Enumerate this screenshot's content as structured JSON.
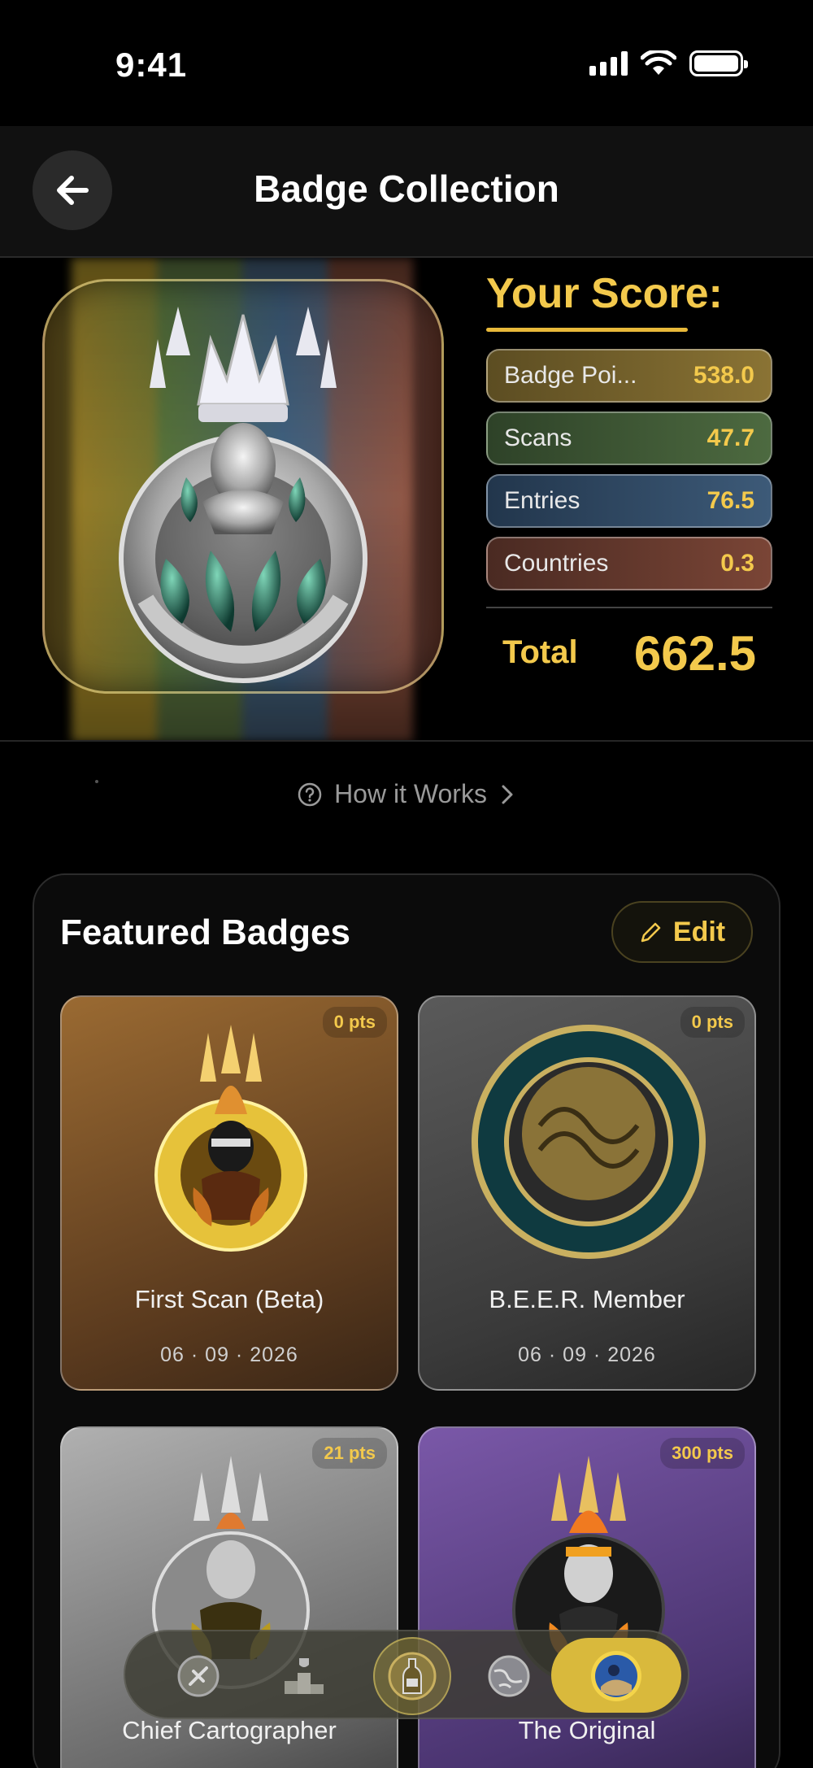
{
  "status_bar": {
    "time": "9:41"
  },
  "header": {
    "title": "Badge Collection"
  },
  "score": {
    "title": "Your Score:",
    "rows": [
      {
        "label": "Badge Poi...",
        "value": "538.0",
        "color": "#8a7334"
      },
      {
        "label": "Scans",
        "value": "47.7",
        "color": "#4d6a40"
      },
      {
        "label": "Entries",
        "value": "76.5",
        "color": "#3d5a78"
      },
      {
        "label": "Countries",
        "value": "0.3",
        "color": "#7a4536"
      }
    ],
    "total_label": "Total",
    "total_value": "662.5"
  },
  "how_it_works": {
    "label": "How it Works"
  },
  "featured": {
    "title": "Featured Badges",
    "edit_label": "Edit",
    "badges": [
      {
        "name": "First Scan (Beta)",
        "points": "0 pts",
        "date": "06 · 09 · 2026",
        "color": "#8a5a2a"
      },
      {
        "name": "B.E.E.R. Member",
        "points": "0 pts",
        "date": "06 · 09 · 2026",
        "color": "#4a4a4a"
      },
      {
        "name": "Chief Cartographer",
        "points": "21 pts",
        "date": "",
        "color": "#9a9a9a"
      },
      {
        "name": "The Original",
        "points": "300 pts",
        "date": "",
        "color": "#6a4a9a"
      }
    ]
  },
  "tab_bar": {
    "items": [
      {
        "icon": "scan-badge-icon"
      },
      {
        "icon": "leaderboard-icon"
      },
      {
        "icon": "bottle-ai-icon"
      },
      {
        "icon": "globe-icon"
      },
      {
        "icon": "profile-avatar-icon"
      }
    ],
    "active_color": "#d9b93c"
  },
  "colors": {
    "accent": "#f3c94c",
    "background": "#000000"
  }
}
